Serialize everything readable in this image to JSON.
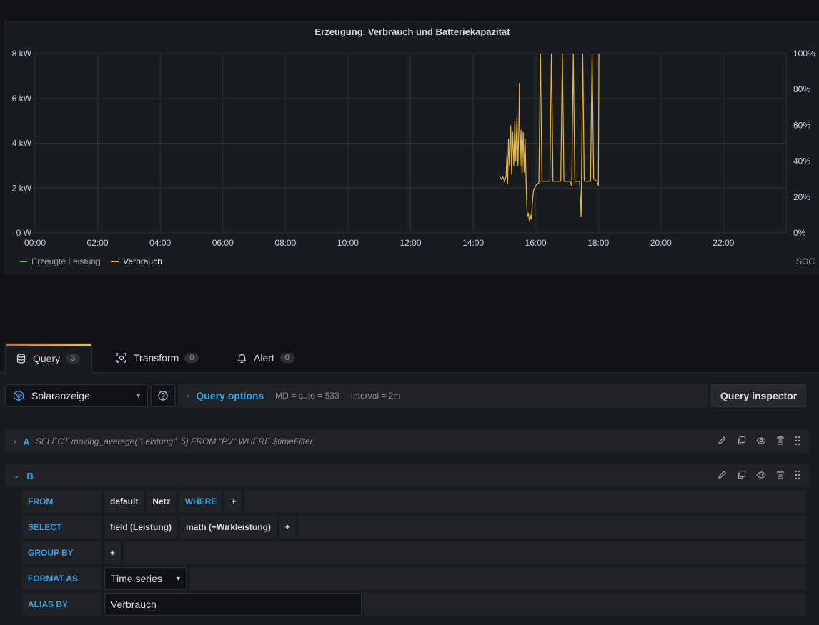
{
  "panel": {
    "title": "Erzeugung, Verbrauch und Batteriekapazität",
    "legend_left": [
      {
        "label": "Erzeugte Leistung",
        "color": "#73bf69"
      },
      {
        "label": "Verbrauch",
        "color": "#eab839"
      }
    ],
    "legend_right": [
      {
        "label": "SOC",
        "color": "#5794f2"
      }
    ]
  },
  "chart_data": {
    "type": "line",
    "title": "Erzeugung, Verbrauch und Batteriekapazität",
    "x_ticks": [
      "00:00",
      "02:00",
      "04:00",
      "06:00",
      "08:00",
      "10:00",
      "12:00",
      "14:00",
      "16:00",
      "18:00",
      "20:00",
      "22:00"
    ],
    "y_left_ticks": [
      "0 W",
      "2 kW",
      "4 kW",
      "6 kW",
      "8 kW"
    ],
    "y_right_ticks": [
      "0%",
      "20%",
      "40%",
      "60%",
      "80%",
      "100%"
    ],
    "x_range_hours": [
      0,
      24
    ],
    "y_left_range_kw": [
      0,
      8
    ],
    "y_right_range_pct": [
      0,
      100
    ],
    "grid": true,
    "legend_placement": "bottom",
    "series": [
      {
        "name": "Erzeugte Leistung",
        "color": "#73bf69",
        "points": []
      },
      {
        "name": "Verbrauch",
        "color": "#eab839",
        "points": [
          [
            14.85,
            2.5
          ],
          [
            14.9,
            2.4
          ],
          [
            14.95,
            2.5
          ],
          [
            15.0,
            2.3
          ],
          [
            15.05,
            2.5
          ],
          [
            15.08,
            3.5
          ],
          [
            15.1,
            2.2
          ],
          [
            15.13,
            4.2
          ],
          [
            15.16,
            3.0
          ],
          [
            15.2,
            4.8
          ],
          [
            15.23,
            2.6
          ],
          [
            15.26,
            4.5
          ],
          [
            15.3,
            3.0
          ],
          [
            15.33,
            5.0
          ],
          [
            15.36,
            3.2
          ],
          [
            15.4,
            5.2
          ],
          [
            15.43,
            3.0
          ],
          [
            15.46,
            4.6
          ],
          [
            15.48,
            6.7
          ],
          [
            15.5,
            3.0
          ],
          [
            15.53,
            4.6
          ],
          [
            15.56,
            2.6
          ],
          [
            15.6,
            4.5
          ],
          [
            15.63,
            2.7
          ],
          [
            15.66,
            4.2
          ],
          [
            15.7,
            1.9
          ],
          [
            15.73,
            0.7
          ],
          [
            15.76,
            0.9
          ],
          [
            15.8,
            0.5
          ],
          [
            15.83,
            0.8
          ],
          [
            15.86,
            0.6
          ],
          [
            15.9,
            1.5
          ],
          [
            15.93,
            1.9
          ],
          [
            15.96,
            2.0
          ],
          [
            16.0,
            2.1
          ],
          [
            16.05,
            2.2
          ],
          [
            16.1,
            2.2
          ],
          [
            16.15,
            8
          ],
          [
            16.2,
            2.3
          ],
          [
            16.3,
            2.3
          ],
          [
            16.45,
            2.3
          ],
          [
            16.5,
            8
          ],
          [
            16.55,
            2.3
          ],
          [
            16.7,
            2.3
          ],
          [
            16.8,
            2.3
          ],
          [
            16.85,
            8
          ],
          [
            16.9,
            2.3
          ],
          [
            17.1,
            2.3
          ],
          [
            17.15,
            2.1
          ],
          [
            17.2,
            8
          ],
          [
            17.25,
            2.3
          ],
          [
            17.4,
            2.3
          ],
          [
            17.45,
            0.7
          ],
          [
            17.5,
            8
          ],
          [
            17.55,
            2.3
          ],
          [
            17.7,
            2.3
          ],
          [
            17.75,
            2.3
          ],
          [
            17.8,
            8
          ],
          [
            17.85,
            2.4
          ],
          [
            17.95,
            2.3
          ],
          [
            18.0,
            2.1
          ],
          [
            18.02,
            8
          ]
        ]
      },
      {
        "name": "SOC",
        "color": "#5794f2",
        "points": []
      }
    ]
  },
  "tabs": [
    {
      "label": "Query",
      "count": "3"
    },
    {
      "label": "Transform",
      "count": "0"
    },
    {
      "label": "Alert",
      "count": "0"
    }
  ],
  "editor": {
    "datasource": "Solaranzeige",
    "query_options_label": "Query options",
    "md": "MD = auto = 533",
    "interval": "Interval = 2m",
    "inspector_label": "Query inspector",
    "queryA": {
      "letter": "A",
      "sql": "SELECT moving_average(\"Leistung\", 5) FROM \"PV\" WHERE $timeFilter"
    },
    "queryB": {
      "letter": "B",
      "from_label": "FROM",
      "from_policy": "default",
      "from_measurement": "Netz",
      "where_label": "WHERE",
      "select_label": "SELECT",
      "select_field": "field (Leistung)",
      "select_math": "math (+Wirkleistung)",
      "groupby_label": "GROUP BY",
      "format_label": "FORMAT AS",
      "format_value": "Time series",
      "alias_label": "ALIAS BY",
      "alias_value": "Verbrauch",
      "plus": "+"
    }
  }
}
